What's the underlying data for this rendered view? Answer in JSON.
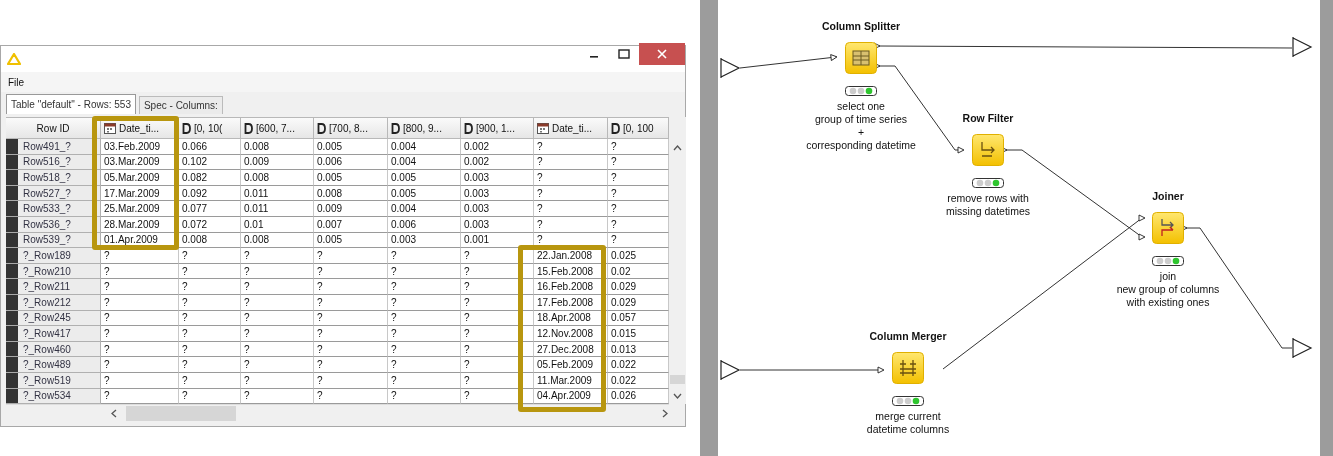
{
  "table_window": {
    "menu": [
      "File"
    ],
    "tabs": [
      {
        "label": "Table \"default\" - Rows: 553",
        "selected": true
      },
      {
        "label": "Spec - Columns:",
        "selected": false
      }
    ],
    "columns": [
      {
        "label": "Row ID",
        "kind": "rowid"
      },
      {
        "label": "Date_ti...",
        "kind": "date"
      },
      {
        "label": "[0, 10(",
        "kind": "double"
      },
      {
        "label": "[600, 7...",
        "kind": "double"
      },
      {
        "label": "[700, 8...",
        "kind": "double"
      },
      {
        "label": "[800, 9...",
        "kind": "double"
      },
      {
        "label": "[900, 1...",
        "kind": "double"
      },
      {
        "label": "Date_ti...",
        "kind": "date"
      },
      {
        "label": "[0, 100",
        "kind": "double"
      }
    ],
    "rows": [
      {
        "id": "Row491_?",
        "cells": [
          "03.Feb.2009",
          "0.066",
          "0.008",
          "0.005",
          "0.004",
          "0.002",
          "?",
          "?"
        ]
      },
      {
        "id": "Row516_?",
        "cells": [
          "03.Mar.2009",
          "0.102",
          "0.009",
          "0.006",
          "0.004",
          "0.002",
          "?",
          "?"
        ]
      },
      {
        "id": "Row518_?",
        "cells": [
          "05.Mar.2009",
          "0.082",
          "0.008",
          "0.005",
          "0.005",
          "0.003",
          "?",
          "?"
        ]
      },
      {
        "id": "Row527_?",
        "cells": [
          "17.Mar.2009",
          "0.092",
          "0.011",
          "0.008",
          "0.005",
          "0.003",
          "?",
          "?"
        ]
      },
      {
        "id": "Row533_?",
        "cells": [
          "25.Mar.2009",
          "0.077",
          "0.011",
          "0.009",
          "0.004",
          "0.003",
          "?",
          "?"
        ]
      },
      {
        "id": "Row536_?",
        "cells": [
          "28.Mar.2009",
          "0.072",
          "0.01",
          "0.007",
          "0.006",
          "0.003",
          "?",
          "?"
        ]
      },
      {
        "id": "Row539_?",
        "cells": [
          "01.Apr.2009",
          "0.008",
          "0.008",
          "0.005",
          "0.003",
          "0.001",
          "?",
          "?"
        ]
      },
      {
        "id": "?_Row189",
        "cells": [
          "?",
          "?",
          "?",
          "?",
          "?",
          "?",
          "22.Jan.2008",
          "0.025"
        ]
      },
      {
        "id": "?_Row210",
        "cells": [
          "?",
          "?",
          "?",
          "?",
          "?",
          "?",
          "15.Feb.2008",
          "0.02"
        ]
      },
      {
        "id": "?_Row211",
        "cells": [
          "?",
          "?",
          "?",
          "?",
          "?",
          "?",
          "16.Feb.2008",
          "0.029"
        ]
      },
      {
        "id": "?_Row212",
        "cells": [
          "?",
          "?",
          "?",
          "?",
          "?",
          "?",
          "17.Feb.2008",
          "0.029"
        ]
      },
      {
        "id": "?_Row245",
        "cells": [
          "?",
          "?",
          "?",
          "?",
          "?",
          "?",
          "18.Apr.2008",
          "0.057"
        ]
      },
      {
        "id": "?_Row417",
        "cells": [
          "?",
          "?",
          "?",
          "?",
          "?",
          "?",
          "12.Nov.2008",
          "0.015"
        ]
      },
      {
        "id": "?_Row460",
        "cells": [
          "?",
          "?",
          "?",
          "?",
          "?",
          "?",
          "27.Dec.2008",
          "0.013"
        ]
      },
      {
        "id": "?_Row489",
        "cells": [
          "?",
          "?",
          "?",
          "?",
          "?",
          "?",
          "05.Feb.2009",
          "0.022"
        ]
      },
      {
        "id": "?_Row519",
        "cells": [
          "?",
          "?",
          "?",
          "?",
          "?",
          "?",
          "11.Mar.2009",
          "0.022"
        ]
      },
      {
        "id": "?_Row534",
        "cells": [
          "?",
          "?",
          "?",
          "?",
          "?",
          "?",
          "04.Apr.2009",
          "0.026"
        ]
      }
    ]
  },
  "workflow": {
    "nodes": [
      {
        "title": "Column Splitter",
        "kind": "splitter",
        "executed": true,
        "annotation": [
          "select one",
          "group of time series",
          "+",
          "corresponding datetime"
        ]
      },
      {
        "title": "Row Filter",
        "kind": "filter",
        "executed": true,
        "annotation": [
          "remove rows with",
          "missing datetimes"
        ]
      },
      {
        "title": "Joiner",
        "kind": "joiner",
        "executed": true,
        "annotation": [
          "join",
          "new group of columns",
          "with existing ones"
        ]
      },
      {
        "title": "Column Merger",
        "kind": "merger",
        "executed": true,
        "annotation": [
          "merge current",
          "datetime columns"
        ]
      }
    ]
  }
}
